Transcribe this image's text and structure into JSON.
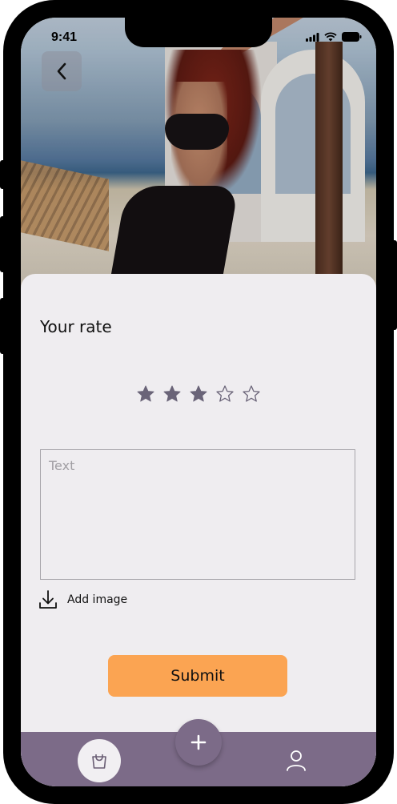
{
  "status_bar": {
    "time": "9:41"
  },
  "header": {
    "back_icon": "chevron-left-icon"
  },
  "rating": {
    "title": "Your rate",
    "value": 3,
    "max": 5,
    "star_color": "#6a6478"
  },
  "review": {
    "placeholder": "Text",
    "value": ""
  },
  "attachment": {
    "icon": "download-icon",
    "label": "Add image"
  },
  "actions": {
    "submit_label": "Submit",
    "submit_color": "#fba452"
  },
  "bottom_nav": {
    "background": "#7c6b88",
    "items": [
      {
        "icon": "shopping-bag-icon",
        "active": true
      },
      {
        "icon": "plus-icon",
        "active": false
      },
      {
        "icon": "user-icon",
        "active": false
      }
    ]
  }
}
